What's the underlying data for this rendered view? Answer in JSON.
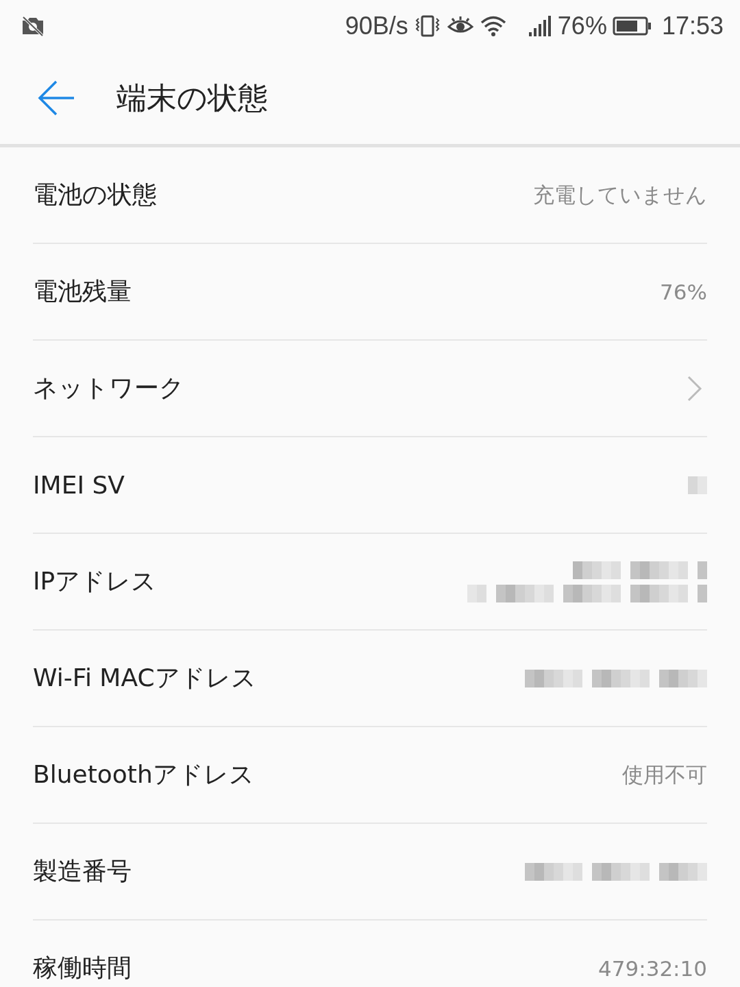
{
  "status_bar": {
    "speed": "90B/s",
    "battery": "76%",
    "time": "17:53"
  },
  "header": {
    "title": "端末の状態"
  },
  "rows": [
    {
      "label": "電池の状態",
      "kind": "text",
      "value": "充電していません"
    },
    {
      "label": "電池残量",
      "kind": "text",
      "value": "76%"
    },
    {
      "label": "ネットワーク",
      "kind": "link"
    },
    {
      "label": "IMEI SV",
      "kind": "blurred_short"
    },
    {
      "label": "IPアドレス",
      "kind": "blurred_double"
    },
    {
      "label": "Wi-Fi MACアドレス",
      "kind": "blurred_long"
    },
    {
      "label": "Bluetoothアドレス",
      "kind": "text",
      "value": "使用不可"
    },
    {
      "label": "製造番号",
      "kind": "blurred_long"
    },
    {
      "label": "稼働時間",
      "kind": "text",
      "value": "479:32:10"
    }
  ]
}
